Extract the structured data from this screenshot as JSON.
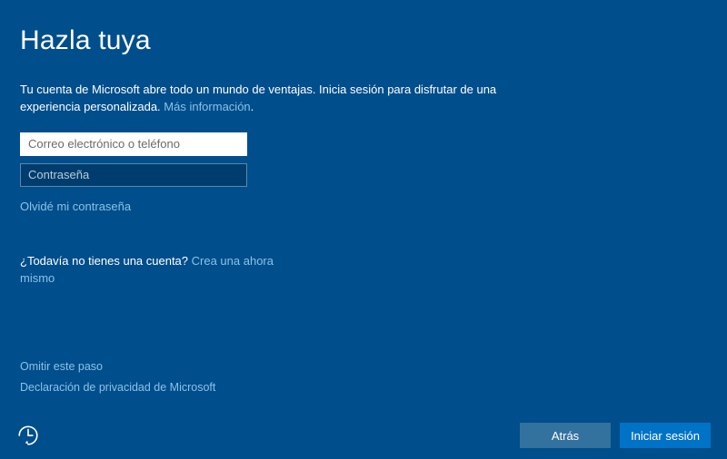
{
  "title": "Hazla tuya",
  "description": {
    "text_a": "Tu cuenta de Microsoft abre todo un mundo de ventajas. Inicia sesión para disfrutar de una experiencia personalizada. ",
    "more_info": "Más información",
    "text_b": "."
  },
  "form": {
    "email_placeholder": "Correo electrónico o teléfono",
    "password_placeholder": "Contraseña",
    "forgot": "Olvidé mi contraseña"
  },
  "no_account": {
    "question": "¿Todavía no tienes una cuenta? ",
    "create": "Crea una ahora mismo"
  },
  "bottom": {
    "skip": "Omitir este paso",
    "privacy": "Declaración de privacidad de Microsoft"
  },
  "footer": {
    "back": "Atrás",
    "signin": "Iniciar sesión"
  }
}
